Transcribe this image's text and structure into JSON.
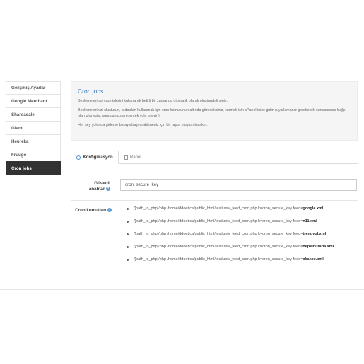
{
  "sidebar": {
    "items": [
      {
        "label": "Gelişmiş Ayarlar"
      },
      {
        "label": "Google Merchant"
      },
      {
        "label": "Shareasale"
      },
      {
        "label": "Glami"
      },
      {
        "label": "Heureka"
      },
      {
        "label": "Fruugo"
      },
      {
        "label": "Cron jobs",
        "active": true
      }
    ]
  },
  "info": {
    "title": "Cron jobs",
    "p1": "Beslemelerinizi cron işlerini kullanarak belirli bir zamanda otomatik olarak oluşturabilirsiniz.",
    "p2": "Beslemelerinizi oluşturun, ardından kullanmak için cron komutunun altında göreceksiniz, kurmak için cPanel inize gidin (uyarlamanız gerekecek sunucunuza bağlı olan php yolu, sunucunuzdan gerçek yolu isteyin).",
    "p3": "Her şey yolunda giderse buraya başvurabilmeniz için bir rapor oluşturulacaktır."
  },
  "tabs": {
    "config": "Konfigürasyon",
    "report": "Rapor"
  },
  "form": {
    "key_label_1": "Güvenli",
    "key_label_2": "anahtar",
    "key_value": "cron_secure_key",
    "cmd_label": "Cron komutları"
  },
  "commands": [
    {
      "path": "/[path_to_php]/php /home/ddoetica/public_html/test/univ_feed_cron.php k=cron_secure_key feed=",
      "feed": "google.xml"
    },
    {
      "path": "/[path_to_php]/php /home/ddoetica/public_html/test/univ_feed_cron.php k=cron_secure_key feed=",
      "feed": "n11.xml"
    },
    {
      "path": "/[path_to_php]/php /home/ddoetica/public_html/test/univ_feed_cron.php k=cron_secure_key feed=",
      "feed": "trendyol.xml"
    },
    {
      "path": "/[path_to_php]/php /home/ddoetica/public_html/test/univ_feed_cron.php k=cron_secure_key feed=",
      "feed": "hepsiburada.xml"
    },
    {
      "path": "/[path_to_php]/php /home/ddoetica/public_html/test/univ_feed_cron.php k=cron_secure_key feed=",
      "feed": "akakce.xml"
    }
  ],
  "colors": {
    "accent": "#3a7bbf",
    "active_sidebar": "#323232"
  }
}
